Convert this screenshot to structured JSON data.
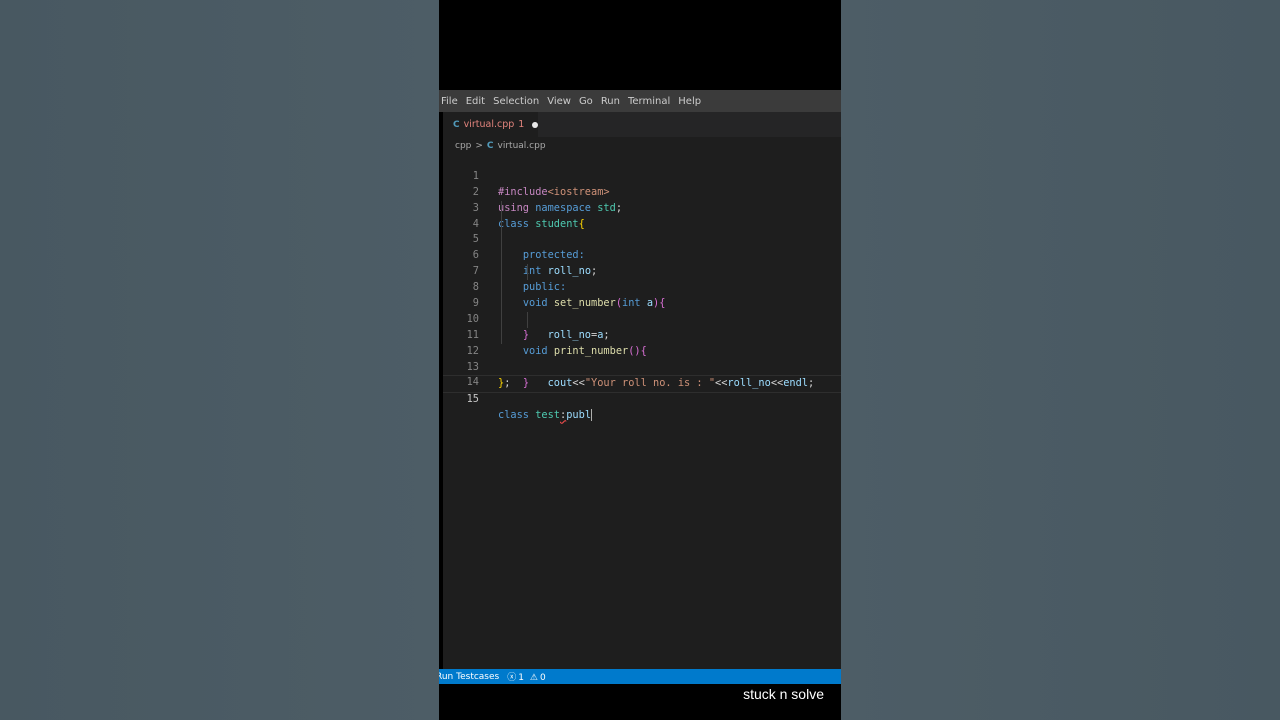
{
  "menu": [
    "File",
    "Edit",
    "Selection",
    "View",
    "Go",
    "Run",
    "Terminal",
    "Help"
  ],
  "tab": {
    "icon": "C",
    "label": "virtual.cpp",
    "problem_count": "1",
    "modified": true
  },
  "breadcrumb": {
    "folder": "cpp",
    "icon": "C",
    "file": "virtual.cpp"
  },
  "code": {
    "line_numbers": [
      "1",
      "2",
      "3",
      "4",
      "5",
      "6",
      "7",
      "8",
      "9",
      "10",
      "11",
      "12",
      "13",
      "14",
      "15"
    ],
    "current_line": 15
  },
  "statusbar": {
    "run_label": "Run Testcases",
    "errors": "1",
    "warnings": "0"
  },
  "watermark": "stuck n solve",
  "colors": {
    "statusbar": "#007acc",
    "editor_bg": "#1e1e1e",
    "tab_modified": "#e2847d"
  }
}
